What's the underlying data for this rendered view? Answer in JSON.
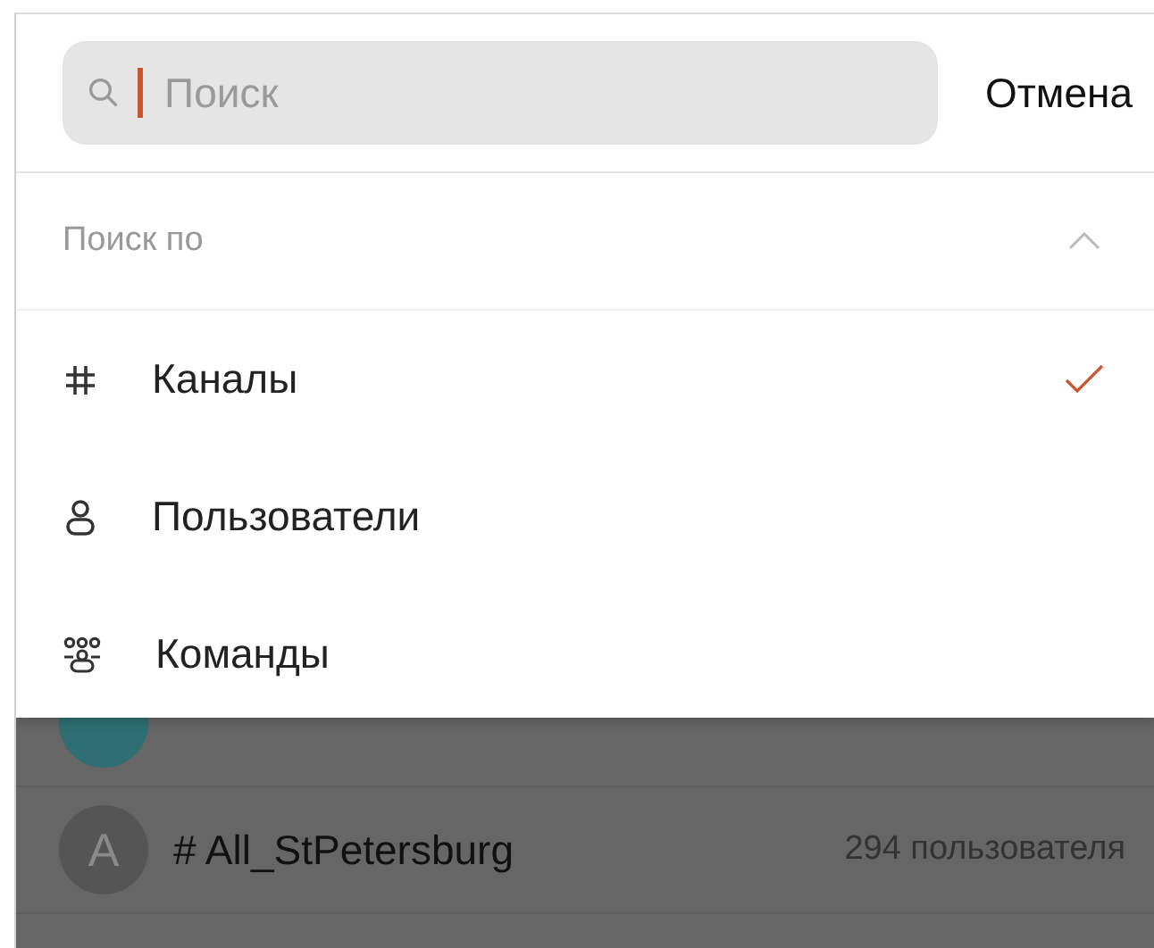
{
  "search": {
    "placeholder": "Поиск",
    "focused": true
  },
  "cancel_button": "Отмена",
  "filter": {
    "title": "Поиск по",
    "expanded": true,
    "options": [
      {
        "kind": "channels",
        "label": "Каналы",
        "selected": true
      },
      {
        "kind": "users",
        "label": "Пользователи",
        "selected": false
      },
      {
        "kind": "teams",
        "label": "Команды",
        "selected": false
      }
    ]
  },
  "channels": [
    {
      "color": "#2f6e72"
    },
    {
      "avatar": "A",
      "name": "# All_StPetersburg",
      "members": "294 пользователя",
      "color": "#555555"
    }
  ]
}
